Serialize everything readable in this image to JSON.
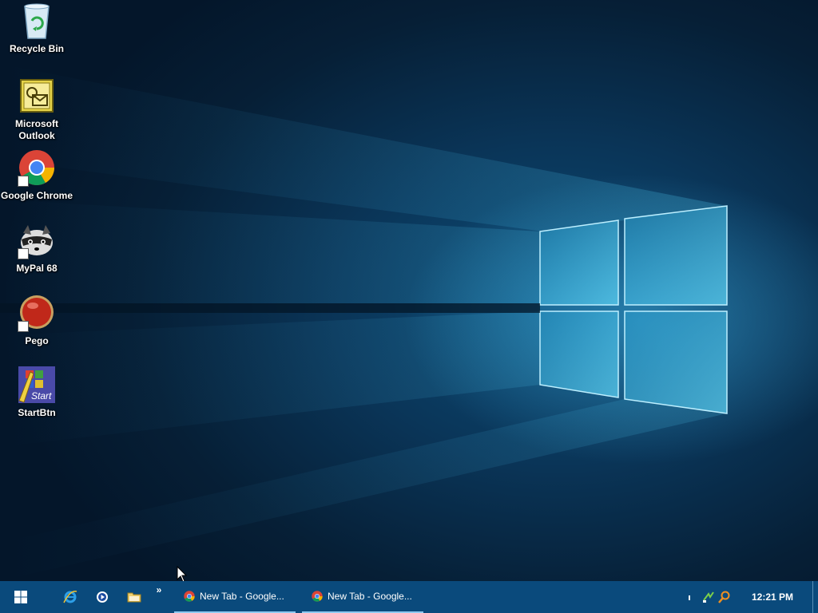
{
  "desktop": {
    "icons": [
      {
        "label": "Recycle Bin",
        "icon": "recycle-bin-icon"
      },
      {
        "label": "Microsoft Outlook",
        "icon": "outlook-icon"
      },
      {
        "label": "Google Chrome",
        "icon": "chrome-icon"
      },
      {
        "label": "MyPal 68",
        "icon": "mypal-raccoon-icon"
      },
      {
        "label": "Pego",
        "icon": "pego-red-ball-icon"
      },
      {
        "label": "StartBtn",
        "icon": "startbtn-icon"
      }
    ],
    "startbtn_icon_text": "Start"
  },
  "taskbar": {
    "start_icon": "windows-logo-icon",
    "quick_launch": [
      {
        "icon": "internet-explorer-icon"
      },
      {
        "icon": "media-player-icon"
      },
      {
        "icon": "folder-icon"
      }
    ],
    "chevron": "»",
    "tasks": [
      {
        "label": "New Tab - Google...",
        "icon": "chrome-icon"
      },
      {
        "label": "New Tab - Google...",
        "icon": "chrome-icon"
      }
    ],
    "tray": {
      "icons": [
        "tray-small-icon",
        "network-icon",
        "search-icon"
      ],
      "clock": "12:21 PM"
    }
  },
  "colors": {
    "taskbar_bg": "#0a4a7c",
    "task_underline": "#8ec9f0",
    "wallpaper_glow": "#3caadc"
  }
}
